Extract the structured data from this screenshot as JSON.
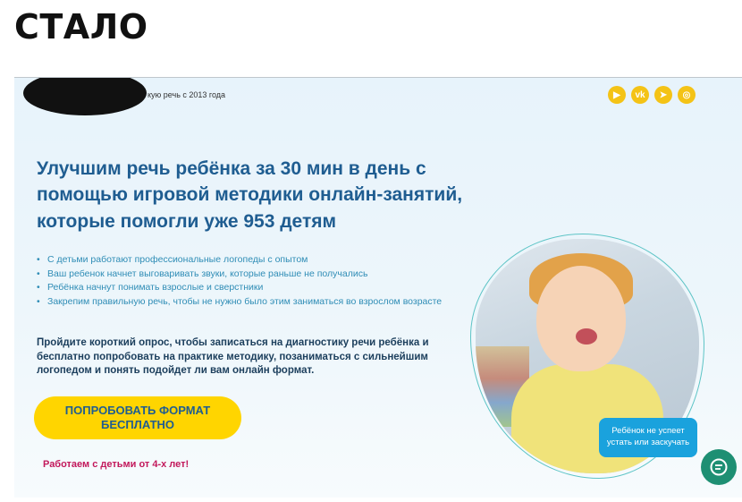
{
  "caption": "СТАЛО",
  "header": {
    "tagline": "кую речь с 2013 года",
    "socials": [
      {
        "icon": "youtube-icon",
        "glyph": "▶"
      },
      {
        "icon": "vk-icon",
        "glyph": "vk"
      },
      {
        "icon": "telegram-icon",
        "glyph": "➤"
      },
      {
        "icon": "instagram-icon",
        "glyph": "◎"
      }
    ]
  },
  "hero": {
    "headline": "Улучшим речь ребёнка за 30 мин в день с помощью игровой методики онлайн-занятий, которые помогли уже 953 детям",
    "bullets": [
      "С детьми работают профессиональные логопеды с опытом",
      "Ваш ребенок начнет выговаривать звуки, которые раньше не получались",
      "Ребёнка начнут понимать взрослые и сверстники",
      "Закрепим правильную речь, чтобы не нужно было этим заниматься во взрослом возрасте"
    ],
    "cta_text": "Пройдите короткий опрос, чтобы записаться на диагностику речи ребёнка и бесплатно попробовать на практике методику, позаниматься с сильнейшим логопедом и понять подойдет ли вам онлайн формат.",
    "cta_button": "ПОПРОБОВАТЬ ФОРМАТ БЕСПЛАТНО",
    "age_note": "Работаем с детьми от 4-х лет!",
    "photo_bubble": "Ребёнок не успеет устать или заскучать"
  },
  "colors": {
    "headline": "#1f5d91",
    "bullets": "#2f8db6",
    "cta_button_bg": "#ffd500",
    "age_note": "#c2185b",
    "social_bg": "#f4c316",
    "chat_button": "#1e8f73",
    "bubble_bg": "#1aa2dd"
  }
}
